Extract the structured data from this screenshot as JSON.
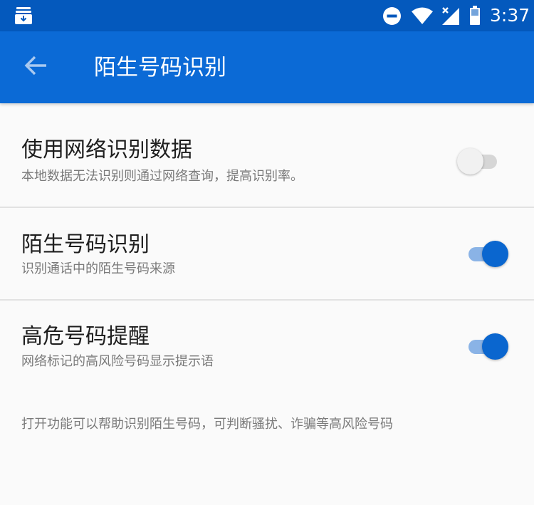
{
  "status_bar": {
    "time": "3:37",
    "icons": [
      "download-notification-icon",
      "do-not-disturb-icon",
      "wifi-icon",
      "cellular-signal-icon",
      "battery-icon"
    ]
  },
  "app_bar": {
    "title": "陌生号码识别",
    "back_icon": "arrow-left-icon"
  },
  "settings": [
    {
      "title": "使用网络识别数据",
      "description": "本地数据无法识别则通过网络查询，提高识别率。",
      "enabled": false
    },
    {
      "title": "陌生号码识别",
      "description": "识别通话中的陌生号码来源",
      "enabled": true
    },
    {
      "title": "高危号码提醒",
      "description": "网络标记的高风险号码显示提示语",
      "enabled": true
    }
  ],
  "footer_note": "打开功能可以帮助识别陌生号码，可判断骚扰、诈骗等高风险号码",
  "colors": {
    "status_bar": "#0459bd",
    "app_bar": "#0b6ad6",
    "switch_on_thumb": "#0a66cf",
    "switch_on_track": "#8ab3e6",
    "switch_off_thumb": "#f1f1f1",
    "switch_off_track": "#d6d6d6"
  }
}
